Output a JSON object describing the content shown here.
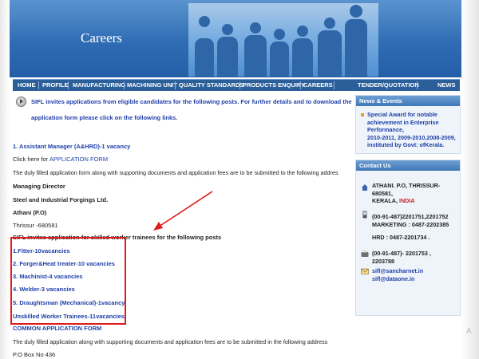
{
  "banner": {
    "title": "Careers"
  },
  "nav": [
    "HOME",
    "PROFILE",
    "MANUFACTURING",
    "MACHINING UNIT",
    "QUALITY STANDARDS",
    "PRODUCTS ENQUIRY",
    "CAREERS",
    "TENDER/QUOTATION",
    "NEWS"
  ],
  "main": {
    "intro_line1": "SIFL invites applications from eligible candidates for the following posts. For further details and to download the",
    "intro_line2": "application form please click on the following links.",
    "post1": "1. Assistant Manager (A&HRD)-1 vacancy",
    "click_prefix": "Click here for ",
    "click_link": "APPLICATION FORM",
    "submit_text": "The duly filled application form along with supporting documents and application fees are to be submitted to the following addres",
    "addr1": "Managing Director",
    "addr2": "Steel and Industrial Forgings Ltd.",
    "addr3": "Athani (P.O)",
    "addr4": "Thrissur -680581",
    "trainee_intro": "SIFL invites application for skilled worker trainees for the following posts",
    "trainees": [
      "1.Fitter-10vacancies",
      "2. Forger&Heat treater-10 vacancies",
      "3. Machinist-4 vacancies",
      "4. Welder-3 vacancies",
      "5. Draughtsman (Mechanical)-1vacancy",
      "Unskilled Worker Trainees-11vacancies"
    ],
    "common_form": "COMMON APPLICATION FORM",
    "submit_text2": "The duly filled application along with supporting documents and application fees are to be submitted in the following address",
    "po_box": "P.O Box No 436"
  },
  "news": {
    "title": "News & Events",
    "lines": [
      "Special Award for notable",
      "achievement in Enterprise",
      "Performance,",
      "2010-2011, 2009-2010,2008-2009,",
      "instituted by Govt: ofKerala."
    ]
  },
  "contact": {
    "title": "Contact Us",
    "addr_line1": "ATHANI. P.O, THRISSUR-",
    "addr_line2": "680581,",
    "addr_line3_prefix": "KERALA, ",
    "addr_country": "INDIA",
    "phone1": "(00-91-487)2201751,2201752",
    "marketing": "MARKETING : 0487-2202385",
    "hrd": "HRD : 0487-2201734 .",
    "fax_line1": "(00-91-487)- 2201753 ,",
    "fax_line2": "2203788",
    "email1": "sifl@sancharnet.in",
    "email2": "sifl@dataone.in"
  },
  "colors": {
    "link_blue": "#1f3fa8",
    "highlight_red": "#e01b1b",
    "nav_bg": "#2a5f99",
    "banner_blue": "#2f6cb3"
  },
  "icons": [
    "play-circle-icon",
    "arrow-icon",
    "bullet-icon",
    "home-icon",
    "phone-icon",
    "fax-icon",
    "mail-icon"
  ]
}
